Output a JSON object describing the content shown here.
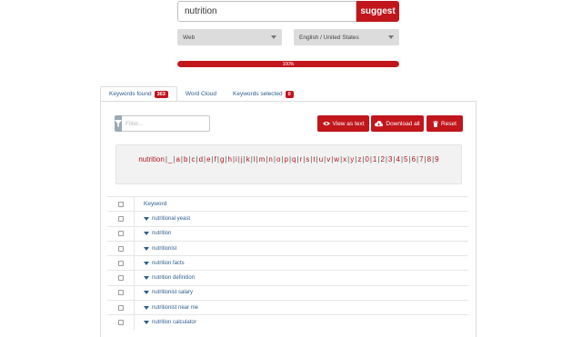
{
  "search": {
    "value": "nutrition",
    "suggest_label": "suggest"
  },
  "selects": {
    "source": "Web",
    "language": "English / United States"
  },
  "progress": {
    "label": "100%",
    "fraction": 1.0
  },
  "tabs": [
    {
      "label": "Keywords found",
      "badge": "363"
    },
    {
      "label": "Word Cloud"
    },
    {
      "label": "Keywords selected",
      "badge": "0"
    }
  ],
  "filter": {
    "placeholder": "Filter..."
  },
  "actions": {
    "view_as_text": "View as text",
    "download_all": "Download all",
    "reset": "Reset"
  },
  "alphabet": [
    "nutrition",
    "_",
    "a",
    "b",
    "c",
    "d",
    "e",
    "f",
    "g",
    "h",
    "i",
    "j",
    "k",
    "l",
    "m",
    "n",
    "o",
    "p",
    "q",
    "r",
    "s",
    "t",
    "u",
    "v",
    "w",
    "x",
    "y",
    "z",
    "0",
    "1",
    "2",
    "3",
    "4",
    "5",
    "6",
    "7",
    "8",
    "9"
  ],
  "table": {
    "header": "Keyword",
    "rows": [
      "nutritional yeast",
      "nutrition",
      "nutritionist",
      "nutrition facts",
      "nutrition definition",
      "nutritionist salary",
      "nutritionist near me",
      "nutrition calculator"
    ]
  },
  "colors": {
    "accent": "#c1161c",
    "link": "#2b5e8c"
  },
  "icons": {
    "filter": "filter-icon",
    "view": "eye-icon",
    "download": "cloud-download-icon",
    "reset": "trash-icon"
  }
}
